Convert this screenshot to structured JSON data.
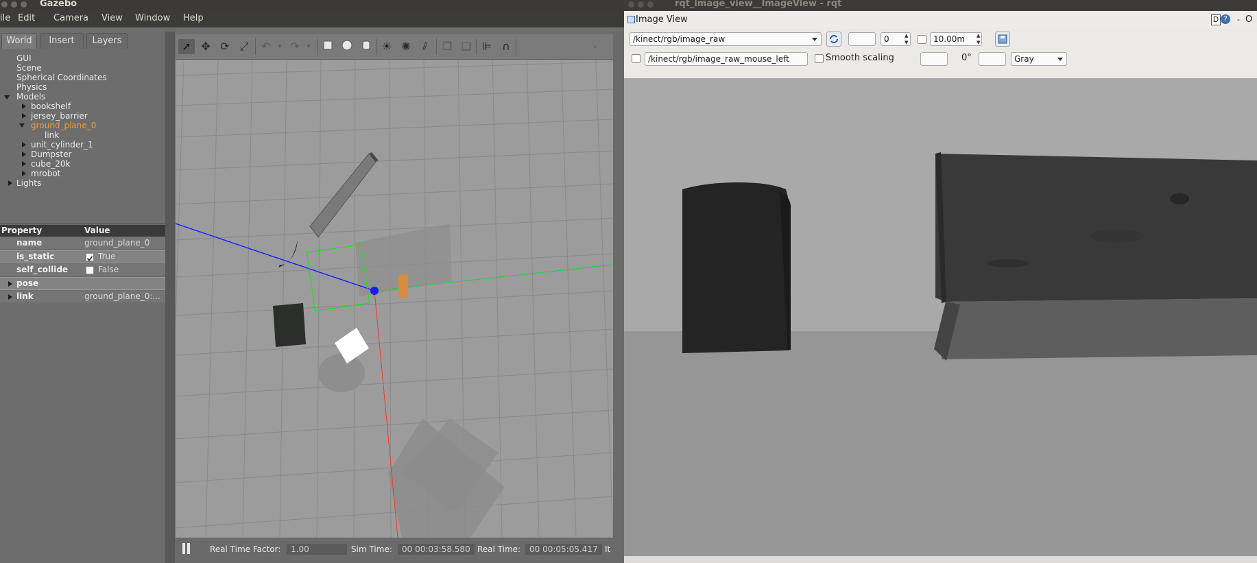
{
  "gazebo": {
    "title": "Gazebo",
    "menu": [
      "ile",
      "Edit",
      "Camera",
      "View",
      "Window",
      "Help"
    ],
    "tabs": [
      "World",
      "Insert",
      "Layers"
    ],
    "tree": {
      "gui": "GUI",
      "scene": "Scene",
      "spherical": "Spherical Coordinates",
      "physics": "Physics",
      "models": "Models",
      "model_items": [
        "bookshelf",
        "jersey_barrier",
        "ground_plane_0",
        "link",
        "unit_cylinder_1",
        "Dumpster",
        "cube_20k",
        "mrobot"
      ],
      "lights": "Lights"
    },
    "properties": {
      "header_property": "Property",
      "header_value": "Value",
      "name_key": "name",
      "name_val": "ground_plane_0",
      "static_key": "is_static",
      "static_val": "True",
      "collide_key": "self_collide",
      "collide_val": "False",
      "pose_key": "pose",
      "link_key": "link",
      "link_val": "ground_plane_0:..."
    },
    "status": {
      "rtf_label": "Real Time Factor:",
      "rtf_value": "1.00",
      "sim_label": "Sim Time:",
      "sim_value": "00 00:03:58.580",
      "real_label": "Real Time:",
      "real_value": "00 00:05:05.417",
      "iter_label": "It"
    },
    "colors": {
      "selected": "#f39c2f",
      "x_axis": "#ff2020",
      "y_axis": "#2ecc40",
      "z_axis": "#1020ff"
    }
  },
  "rqt": {
    "title": "rqt_image_view__ImageView - rqt",
    "dock_title": "Image View",
    "dock_buttons": [
      "D",
      "?"
    ],
    "dock_right_label": "O",
    "topic": "/kinect/rgb/image_raw",
    "min_value": "0",
    "max_value": "10.00m",
    "mouse_topic": "/kinect/rgb/image_raw_mouse_left",
    "smooth_label": "Smooth scaling",
    "rotation": "0°",
    "colormap": "Gray"
  }
}
